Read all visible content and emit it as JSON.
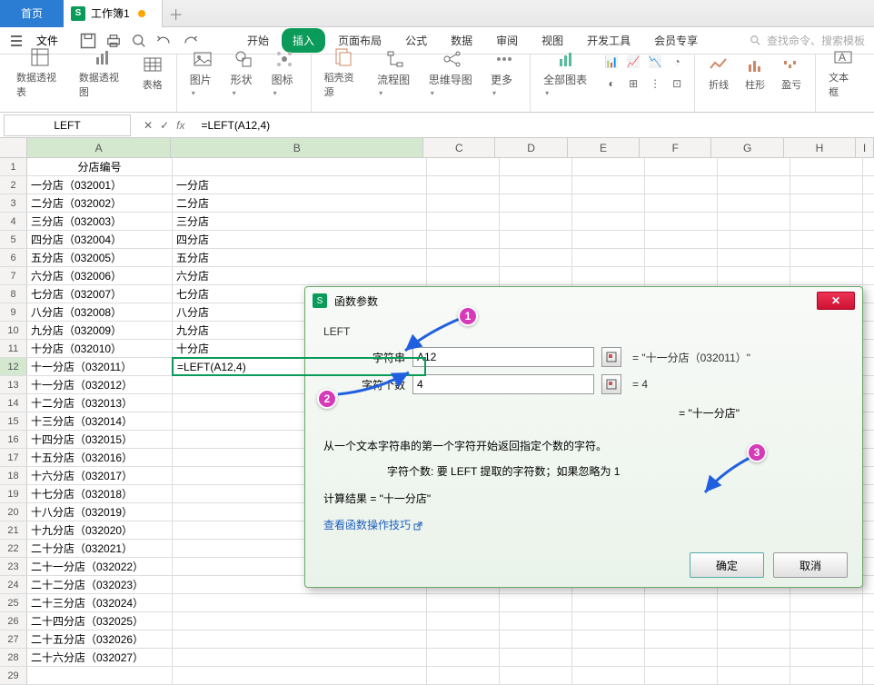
{
  "tabs": {
    "home": "首页",
    "workbook": "工作簿1"
  },
  "file_menu": "文件",
  "menu": {
    "start": "开始",
    "insert": "插入",
    "layout": "页面布局",
    "formula": "公式",
    "data": "数据",
    "review": "审阅",
    "view": "视图",
    "dev": "开发工具",
    "member": "会员专享"
  },
  "search_placeholder": "查找命令、搜索模板",
  "ribbon": {
    "pivot_table": "数据透视表",
    "pivot_chart": "数据透视图",
    "table": "表格",
    "picture": "图片",
    "shape": "形状",
    "icon": "图标",
    "docer": "稻壳资源",
    "flowchart": "流程图",
    "mindmap": "思维导图",
    "more": "更多",
    "all_charts": "全部图表",
    "line": "折线",
    "column": "柱形",
    "winloss": "盈亏",
    "textbox": "文本框"
  },
  "name_box": "LEFT",
  "formula": "=LEFT(A12,4)",
  "columns": [
    "A",
    "B",
    "C",
    "D",
    "E",
    "F",
    "G",
    "H",
    "I"
  ],
  "header_row": "分店编号",
  "rows": [
    {
      "a": "一分店（032001）",
      "b": "一分店"
    },
    {
      "a": "二分店（032002）",
      "b": "二分店"
    },
    {
      "a": "三分店（032003）",
      "b": "三分店"
    },
    {
      "a": "四分店（032004）",
      "b": "四分店"
    },
    {
      "a": "五分店（032005）",
      "b": "五分店"
    },
    {
      "a": "六分店（032006）",
      "b": "六分店"
    },
    {
      "a": "七分店（032007）",
      "b": "七分店"
    },
    {
      "a": "八分店（032008）",
      "b": "八分店"
    },
    {
      "a": "九分店（032009）",
      "b": "九分店"
    },
    {
      "a": "十分店（032010）",
      "b": "十分店"
    },
    {
      "a": "十一分店（032011）",
      "b": "=LEFT(A12,4)"
    },
    {
      "a": "十一分店（032012）",
      "b": ""
    },
    {
      "a": "十二分店（032013）",
      "b": ""
    },
    {
      "a": "十三分店（032014）",
      "b": ""
    },
    {
      "a": "十四分店（032015）",
      "b": ""
    },
    {
      "a": "十五分店（032016）",
      "b": ""
    },
    {
      "a": "十六分店（032017）",
      "b": ""
    },
    {
      "a": "十七分店（032018）",
      "b": ""
    },
    {
      "a": "十八分店（032019）",
      "b": ""
    },
    {
      "a": "十九分店（032020）",
      "b": ""
    },
    {
      "a": "二十分店（032021）",
      "b": ""
    },
    {
      "a": "二十一分店（032022）",
      "b": ""
    },
    {
      "a": "二十二分店（032023）",
      "b": ""
    },
    {
      "a": "二十三分店（032024）",
      "b": ""
    },
    {
      "a": "二十四分店（032025）",
      "b": ""
    },
    {
      "a": "二十五分店（032026）",
      "b": ""
    },
    {
      "a": "二十六分店（032027）",
      "b": ""
    },
    {
      "a": "",
      "b": ""
    }
  ],
  "dialog": {
    "title": "函数参数",
    "func": "LEFT",
    "param1_label": "字符串",
    "param1_value": "A12",
    "param1_result": "= \"十一分店（032011）\"",
    "param2_label": "字符个数",
    "param2_value": "4",
    "param2_result": "= 4",
    "eval_result": "= \"十一分店\"",
    "desc1": "从一个文本字符串的第一个字符开始返回指定个数的字符。",
    "desc2_label": "字符个数:",
    "desc2_text": "要 LEFT 提取的字符数；如果忽略为 1",
    "calc_label": "计算结果 = \"十一分店\"",
    "help_link": "查看函数操作技巧",
    "ok": "确定",
    "cancel": "取消"
  },
  "callouts": {
    "c1": "1",
    "c2": "2",
    "c3": "3"
  }
}
